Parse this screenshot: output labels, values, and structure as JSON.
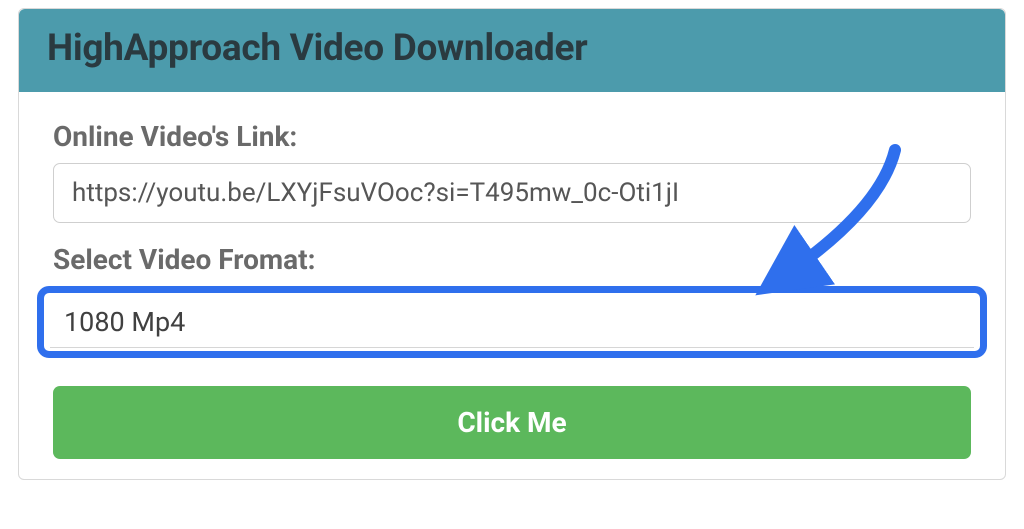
{
  "card": {
    "title": "HighApproach Video Downloader",
    "link_label": "Online Video's Link:",
    "link_value": "https://youtu.be/LXYjFsuVOoc?si=T495mw_0c-Oti1jI",
    "format_label": "Select Video Fromat:",
    "format_value": "1080 Mp4",
    "submit_label": "Click Me"
  },
  "annotation": {
    "arrow_color": "#2f6fed"
  }
}
